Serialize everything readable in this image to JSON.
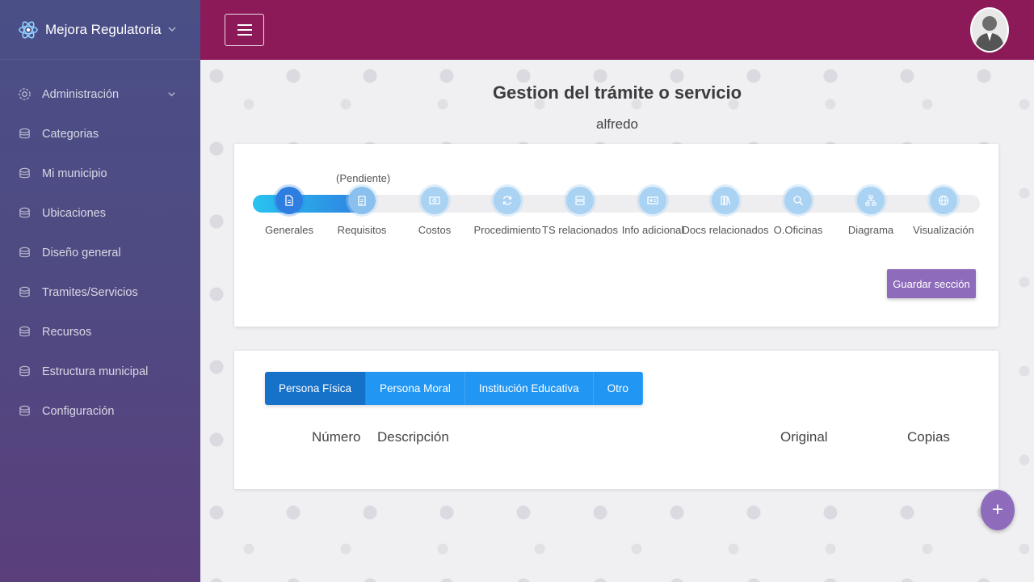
{
  "brand": {
    "title": "Mejora Regulatoria"
  },
  "sidebar": {
    "items": [
      {
        "label": "Administración",
        "has_submenu": true
      },
      {
        "label": "Categorias"
      },
      {
        "label": "Mi municipio"
      },
      {
        "label": "Ubicaciones"
      },
      {
        "label": "Diseño general"
      },
      {
        "label": "Tramites/Servicios"
      },
      {
        "label": "Recursos"
      },
      {
        "label": "Estructura municipal"
      },
      {
        "label": "Configuración"
      }
    ]
  },
  "header": {
    "menu_icon": "hamburger-icon",
    "avatar_icon": "user-avatar"
  },
  "page": {
    "title": "Gestion del trámite o servicio",
    "subtitle": "alfredo"
  },
  "steps": {
    "pending_label": "(Pendiente)",
    "items": [
      {
        "label": "Generales",
        "icon": "document-icon"
      },
      {
        "label": "Requisitos",
        "icon": "clipboard-icon"
      },
      {
        "label": "Costos",
        "icon": "money-icon"
      },
      {
        "label": "Procedimiento",
        "icon": "refresh-icon"
      },
      {
        "label": "TS relacionados",
        "icon": "server-icon"
      },
      {
        "label": "Info adicional",
        "icon": "id-card-icon"
      },
      {
        "label": "Docs relacionados",
        "icon": "books-icon"
      },
      {
        "label": "O.Oficinas",
        "icon": "office-search-icon"
      },
      {
        "label": "Diagrama",
        "icon": "sitemap-icon"
      },
      {
        "label": "Visualización",
        "icon": "globe-icon"
      }
    ],
    "save_label": "Guardar sección"
  },
  "tabs": {
    "items": [
      "Persona Física",
      "Persona Moral",
      "Institución Educativa",
      "Otro"
    ],
    "active": "Persona Física"
  },
  "table": {
    "columns": [
      "Número",
      "Descripción",
      "Original",
      "Copias"
    ]
  },
  "fab": {
    "label": "+"
  },
  "colors": {
    "header": "#8c1a58",
    "accent": "#2196f3",
    "purple_button": "#8e6bbb"
  }
}
